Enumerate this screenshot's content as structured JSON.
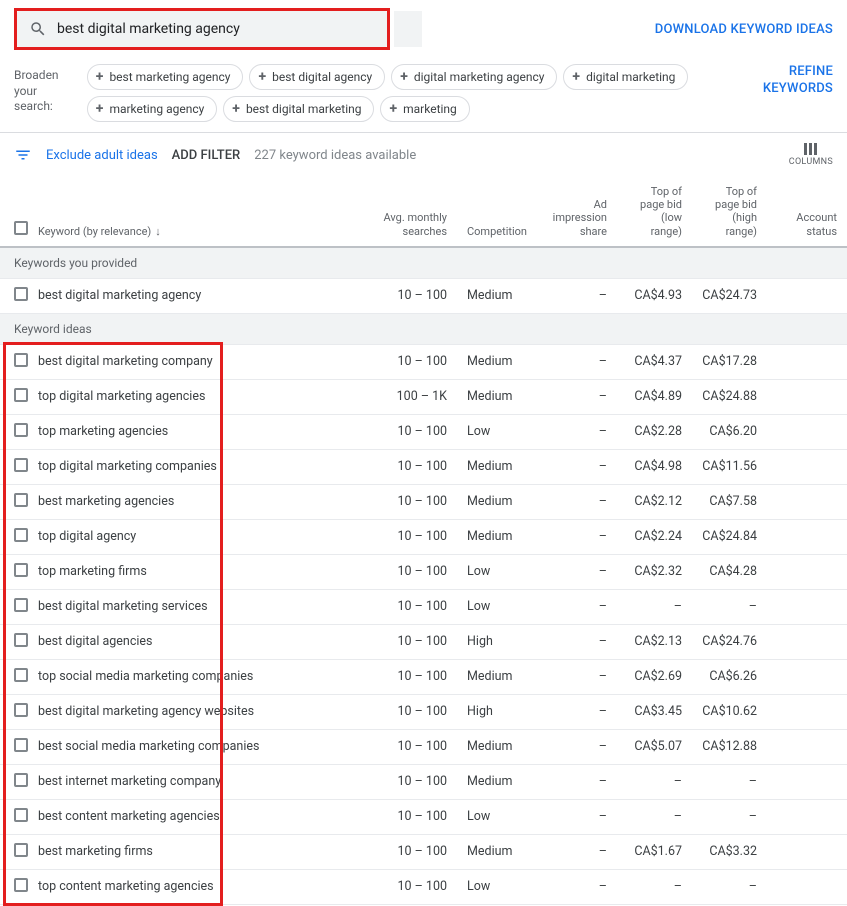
{
  "search": {
    "query": "best digital marketing agency"
  },
  "download_link": "DOWNLOAD KEYWORD IDEAS",
  "broaden": {
    "label": "Broaden your search:",
    "chips": [
      "best marketing agency",
      "best digital agency",
      "digital marketing agency",
      "digital marketing",
      "marketing agency",
      "best digital marketing",
      "marketing"
    ]
  },
  "refine_link": "REFINE KEYWORDS",
  "filter_bar": {
    "exclude_label": "Exclude adult ideas",
    "add_filter_label": "ADD FILTER",
    "count_text": "227 keyword ideas available",
    "columns_label": "COLUMNS"
  },
  "columns": {
    "keyword": "Keyword (by relevance)",
    "searches": "Avg. monthly searches",
    "competition": "Competition",
    "impression": "Ad impression share",
    "bid_low": "Top of page bid (low range)",
    "bid_high": "Top of page bid (high range)",
    "status": "Account status"
  },
  "sections": {
    "provided": "Keywords you provided",
    "ideas": "Keyword ideas"
  },
  "provided_rows": [
    {
      "keyword": "best digital marketing agency",
      "searches": "10 – 100",
      "competition": "Medium",
      "impression": "–",
      "bid_low": "CA$4.93",
      "bid_high": "CA$24.73",
      "status": ""
    }
  ],
  "idea_rows": [
    {
      "keyword": "best digital marketing company",
      "searches": "10 – 100",
      "competition": "Medium",
      "impression": "–",
      "bid_low": "CA$4.37",
      "bid_high": "CA$17.28",
      "status": ""
    },
    {
      "keyword": "top digital marketing agencies",
      "searches": "100 – 1K",
      "competition": "Medium",
      "impression": "–",
      "bid_low": "CA$4.89",
      "bid_high": "CA$24.88",
      "status": ""
    },
    {
      "keyword": "top marketing agencies",
      "searches": "10 – 100",
      "competition": "Low",
      "impression": "–",
      "bid_low": "CA$2.28",
      "bid_high": "CA$6.20",
      "status": ""
    },
    {
      "keyword": "top digital marketing companies",
      "searches": "10 – 100",
      "competition": "Medium",
      "impression": "–",
      "bid_low": "CA$4.98",
      "bid_high": "CA$11.56",
      "status": ""
    },
    {
      "keyword": "best marketing agencies",
      "searches": "10 – 100",
      "competition": "Medium",
      "impression": "–",
      "bid_low": "CA$2.12",
      "bid_high": "CA$7.58",
      "status": ""
    },
    {
      "keyword": "top digital agency",
      "searches": "10 – 100",
      "competition": "Medium",
      "impression": "–",
      "bid_low": "CA$2.24",
      "bid_high": "CA$24.84",
      "status": ""
    },
    {
      "keyword": "top marketing firms",
      "searches": "10 – 100",
      "competition": "Low",
      "impression": "–",
      "bid_low": "CA$2.32",
      "bid_high": "CA$4.28",
      "status": ""
    },
    {
      "keyword": "best digital marketing services",
      "searches": "10 – 100",
      "competition": "Low",
      "impression": "–",
      "bid_low": "–",
      "bid_high": "–",
      "status": ""
    },
    {
      "keyword": "best digital agencies",
      "searches": "10 – 100",
      "competition": "High",
      "impression": "–",
      "bid_low": "CA$2.13",
      "bid_high": "CA$24.76",
      "status": ""
    },
    {
      "keyword": "top social media marketing companies",
      "searches": "10 – 100",
      "competition": "Medium",
      "impression": "–",
      "bid_low": "CA$2.69",
      "bid_high": "CA$6.26",
      "status": ""
    },
    {
      "keyword": "best digital marketing agency websites",
      "searches": "10 – 100",
      "competition": "High",
      "impression": "–",
      "bid_low": "CA$3.45",
      "bid_high": "CA$10.62",
      "status": ""
    },
    {
      "keyword": "best social media marketing companies",
      "searches": "10 – 100",
      "competition": "Medium",
      "impression": "–",
      "bid_low": "CA$5.07",
      "bid_high": "CA$12.88",
      "status": ""
    },
    {
      "keyword": "best internet marketing company",
      "searches": "10 – 100",
      "competition": "Medium",
      "impression": "–",
      "bid_low": "–",
      "bid_high": "–",
      "status": ""
    },
    {
      "keyword": "best content marketing agencies",
      "searches": "10 – 100",
      "competition": "Low",
      "impression": "–",
      "bid_low": "–",
      "bid_high": "–",
      "status": ""
    },
    {
      "keyword": "best marketing firms",
      "searches": "10 – 100",
      "competition": "Medium",
      "impression": "–",
      "bid_low": "CA$1.67",
      "bid_high": "CA$3.32",
      "status": ""
    },
    {
      "keyword": "top content marketing agencies",
      "searches": "10 – 100",
      "competition": "Low",
      "impression": "–",
      "bid_low": "–",
      "bid_high": "–",
      "status": ""
    }
  ]
}
